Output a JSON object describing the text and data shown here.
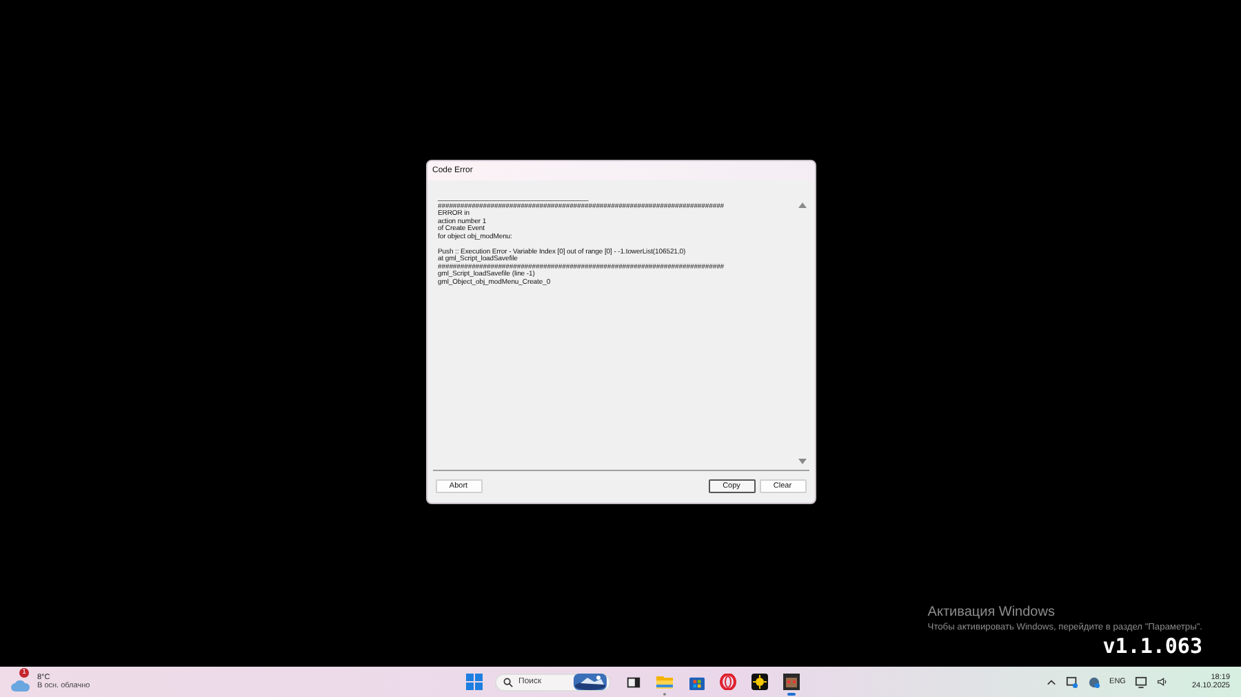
{
  "dialog": {
    "title": "Code Error",
    "blocks": [
      [
        "________________________________________",
        "############################################################################",
        "ERROR in",
        "action number 1",
        "of Create Event",
        "for object obj_modMenu:"
      ],
      [
        "Push :: Execution Error - Variable Index [0] out of range [0] - -1.towerList(106521,0)",
        "at gml_Script_loadSavefile",
        "############################################################################",
        "gml_Script_loadSavefile (line -1)",
        "gml_Object_obj_modMenu_Create_0"
      ]
    ],
    "buttons": [
      {
        "label": "Abort",
        "focused": false
      },
      {
        "label": "Copy",
        "focused": true
      },
      {
        "label": "Clear",
        "focused": false
      }
    ]
  },
  "activation": {
    "title": "Активация Windows",
    "text": "Чтобы активировать Windows, перейдите в раздел \"Параметры\"."
  },
  "version": "v1.1.063",
  "taskbar": {
    "weather": {
      "badge": "1",
      "temperature": "8°C",
      "condition": "В осн. облачно"
    },
    "search": {
      "placeholder": "Поиск"
    },
    "apps": [
      {
        "kind": "taskview",
        "running": false,
        "selected": false
      },
      {
        "kind": "folder",
        "running": true,
        "selected": false
      },
      {
        "kind": "store",
        "running": false,
        "selected": false
      },
      {
        "kind": "opera",
        "running": false,
        "selected": false
      },
      {
        "kind": "sun",
        "running": false,
        "selected": false
      },
      {
        "kind": "game",
        "running": true,
        "selected": true
      }
    ],
    "language": "ENG",
    "time": "18:19",
    "date": "24.10.2025"
  }
}
